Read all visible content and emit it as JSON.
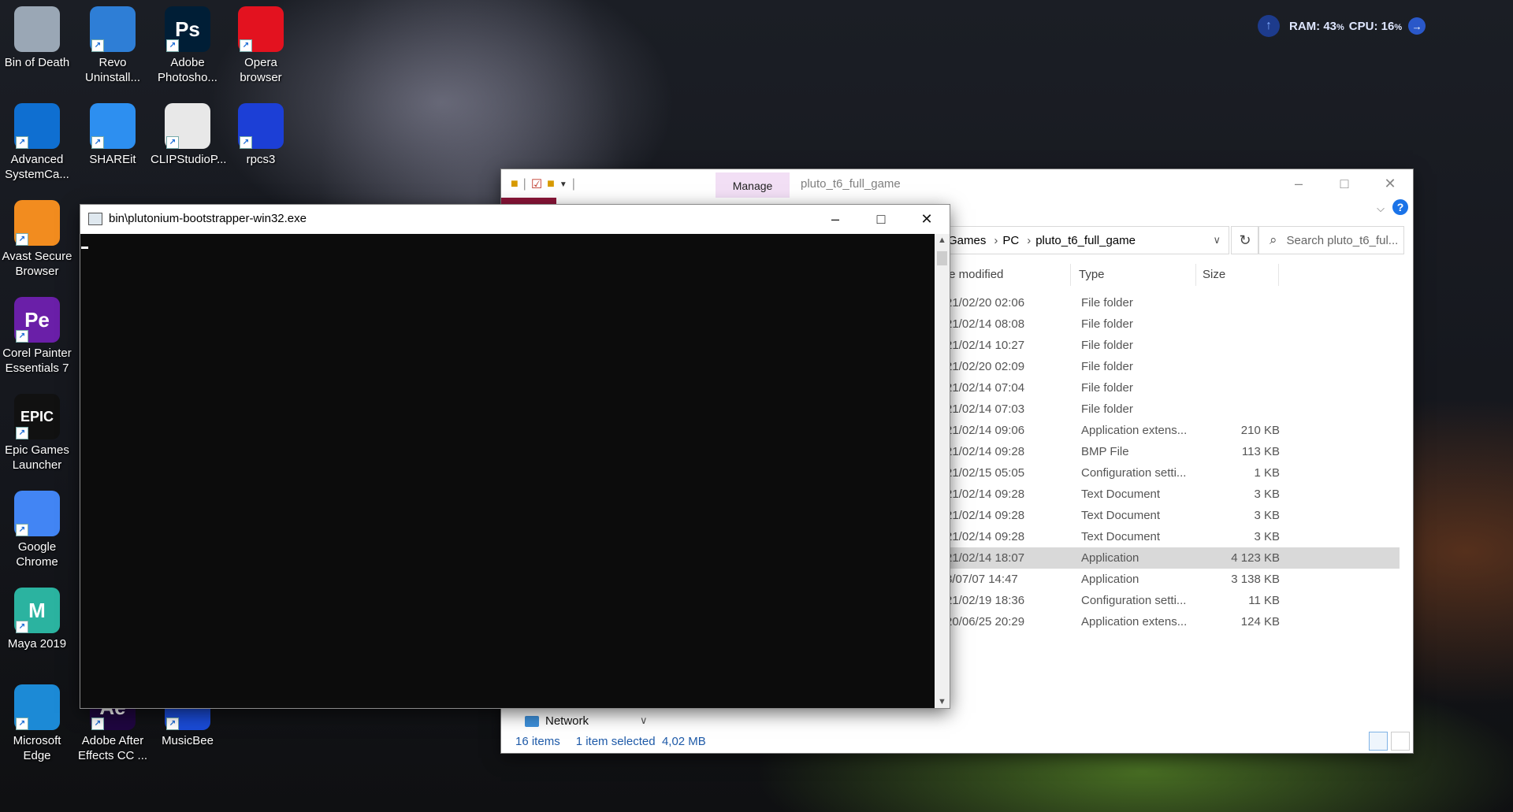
{
  "desktop_icons": [
    {
      "label": "Bin of Death",
      "icon": "recycle-bin-icon",
      "color": "#9aa7b5"
    },
    {
      "label": "Revo Uninstall...",
      "icon": "revo-uninstaller-icon",
      "color": "#2e7ed6"
    },
    {
      "label": "Adobe Photosho...",
      "icon": "photoshop-icon",
      "glyph": "Ps",
      "color": "#001e36"
    },
    {
      "label": "Opera browser",
      "icon": "opera-icon",
      "color": "#e3121f"
    },
    {
      "label": "Advanced SystemCa...",
      "icon": "advanced-systemcare-icon",
      "color": "#0f6fd1"
    },
    {
      "label": "SHAREit",
      "icon": "shareit-icon",
      "color": "#2d8ff0"
    },
    {
      "label": "CLIPStudioP...",
      "icon": "clip-studio-icon",
      "color": "#e8e8e8"
    },
    {
      "label": "rpcs3",
      "icon": "rpcs3-icon",
      "color": "#1c3fd6"
    },
    {
      "label": "Avast Secure Browser",
      "icon": "avast-browser-icon",
      "color": "#f28c1f"
    },
    {
      "label": "Corel Painter Essentials 7",
      "icon": "corel-painter-icon",
      "glyph": "Pe",
      "color": "#6a1fa8"
    },
    {
      "label": "Epic Games Launcher",
      "icon": "epic-games-icon",
      "glyph": "EPIC",
      "color": "#111111"
    },
    {
      "label": "Google Chrome",
      "icon": "chrome-icon",
      "color": "#4285f4"
    },
    {
      "label": "Maya 2019",
      "icon": "maya-icon",
      "glyph": "M",
      "color": "#2bb3a0"
    },
    {
      "label": "Microsoft Edge",
      "icon": "edge-icon",
      "color": "#1c8ad6"
    },
    {
      "label": "Adobe After Effects CC ...",
      "icon": "after-effects-icon",
      "glyph": "Ae",
      "color": "#1f0640"
    },
    {
      "label": "MusicBee",
      "icon": "musicbee-icon",
      "color": "#1a4bd6"
    }
  ],
  "widget": {
    "ram": "RAM: 43",
    "cpu": "CPU: 16",
    "unit": "%"
  },
  "explorer": {
    "title": "pluto_t6_full_game",
    "manage_tab": "Manage",
    "address": [
      "Games",
      "PC",
      "pluto_t6_full_game"
    ],
    "search_placeholder": "Search pluto_t6_ful...",
    "columns": {
      "date": "te modified",
      "type": "Type",
      "size": "Size"
    },
    "rows": [
      {
        "date": "21/02/20 02:06",
        "type": "File folder",
        "size": ""
      },
      {
        "date": "21/02/14 08:08",
        "type": "File folder",
        "size": ""
      },
      {
        "date": "21/02/14 10:27",
        "type": "File folder",
        "size": ""
      },
      {
        "date": "21/02/20 02:09",
        "type": "File folder",
        "size": ""
      },
      {
        "date": "21/02/14 07:04",
        "type": "File folder",
        "size": ""
      },
      {
        "date": "21/02/14 07:03",
        "type": "File folder",
        "size": ""
      },
      {
        "date": "21/02/14 09:06",
        "type": "Application extens...",
        "size": "210 KB"
      },
      {
        "date": "21/02/14 09:28",
        "type": "BMP File",
        "size": "113 KB"
      },
      {
        "date": "21/02/15 05:05",
        "type": "Configuration setti...",
        "size": "1 KB"
      },
      {
        "date": "21/02/14 09:28",
        "type": "Text Document",
        "size": "3 KB"
      },
      {
        "date": "21/02/14 09:28",
        "type": "Text Document",
        "size": "3 KB"
      },
      {
        "date": "21/02/14 09:28",
        "type": "Text Document",
        "size": "3 KB"
      },
      {
        "date": "21/02/14 18:07",
        "type": "Application",
        "size": "4 123 KB",
        "selected": true
      },
      {
        "date": "8/07/07 14:47",
        "type": "Application",
        "size": "3 138 KB"
      },
      {
        "date": "21/02/19 18:36",
        "type": "Configuration setti...",
        "size": "11 KB"
      },
      {
        "date": "20/06/25 20:29",
        "type": "Application extens...",
        "size": "124 KB"
      }
    ],
    "nav_network": "Network",
    "status": {
      "items": "16 items",
      "selected": "1 item selected",
      "size": "4,02 MB"
    }
  },
  "console": {
    "title": "bin\\plutonium-bootstrapper-win32.exe"
  }
}
